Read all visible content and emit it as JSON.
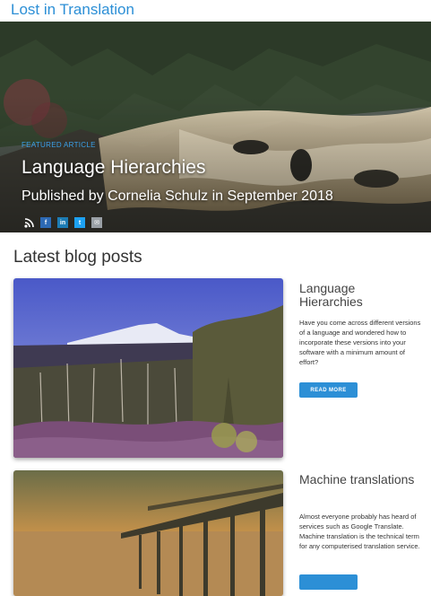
{
  "site": {
    "title": "Lost in Translation"
  },
  "hero": {
    "label": "FEATURED ARTICLE",
    "title": "Language Hierarchies",
    "byline": "Published by Cornelia Schulz in September 2018",
    "share_icons": [
      "rss-icon",
      "facebook-icon",
      "linkedin-icon",
      "twitter-icon",
      "email-icon"
    ],
    "share_glyphs": {
      "facebook": "f",
      "linkedin": "in",
      "twitter": "t",
      "email": "✉"
    }
  },
  "blog": {
    "heading": "Latest blog posts",
    "posts": [
      {
        "title": "Language Hierarchies",
        "excerpt": "Have you come across different versions of a language and wondered how to incorporate these versions into your software with a minimum amount of effort?",
        "button": "READ MORE"
      },
      {
        "title": "Machine translations",
        "excerpt": "Almost everyone probably has heard of services such as Google Translate. Machine translation is the technical term for any computerised translation service."
      }
    ]
  },
  "colors": {
    "accent": "#2c8fd6"
  }
}
